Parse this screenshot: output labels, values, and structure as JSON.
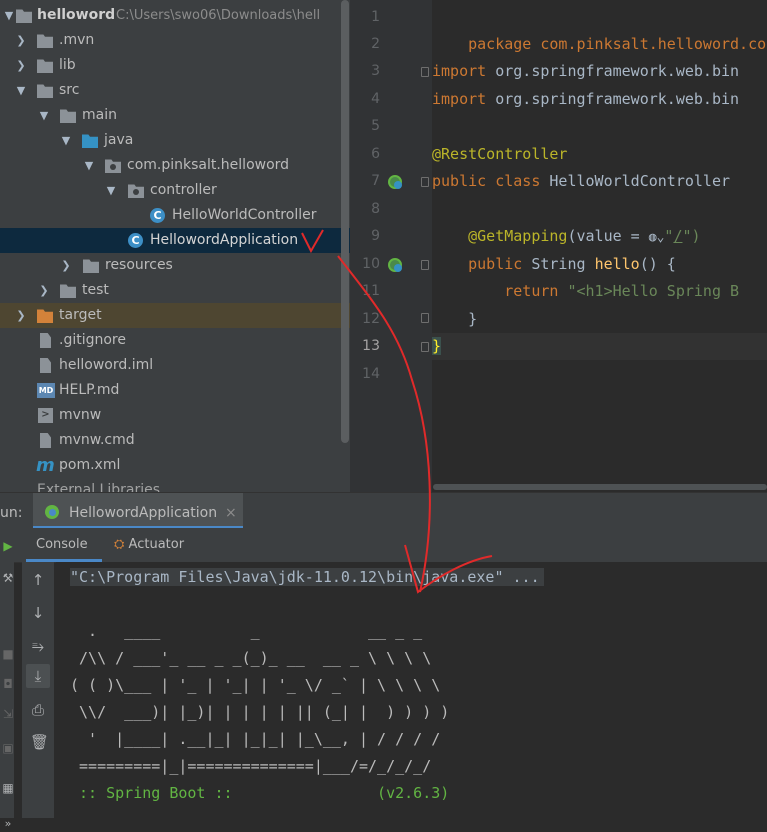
{
  "project_tree": {
    "root": {
      "name": "helloword",
      "path": "C:\\Users\\swo06\\Downloads\\hell"
    },
    "items": [
      {
        "label": ".mvn"
      },
      {
        "label": "lib"
      },
      {
        "label": "src"
      },
      {
        "label": "main"
      },
      {
        "label": "java"
      },
      {
        "label": "com.pinksalt.helloword"
      },
      {
        "label": "controller"
      },
      {
        "label": "HelloWorldController"
      },
      {
        "label": "HellowordApplication"
      },
      {
        "label": "resources"
      },
      {
        "label": "test"
      },
      {
        "label": "target"
      },
      {
        "label": ".gitignore"
      },
      {
        "label": "helloword.iml"
      },
      {
        "label": "HELP.md"
      },
      {
        "label": "mvnw"
      },
      {
        "label": "mvnw.cmd"
      },
      {
        "label": "pom.xml"
      },
      {
        "label": "External Libraries"
      }
    ]
  },
  "editor": {
    "current_line": "13",
    "lines": [
      {
        "n": "1",
        "code": [
          "package com.pinksalt.helloword.con"
        ]
      },
      {
        "n": "2"
      },
      {
        "n": "3",
        "code": [
          "import",
          " org.springframework.web.bin"
        ]
      },
      {
        "n": "4",
        "code": [
          "import",
          " org.springframework.web.bin"
        ]
      },
      {
        "n": "5"
      },
      {
        "n": "6",
        "code": [
          "@RestController"
        ]
      },
      {
        "n": "7",
        "code": [
          "public class",
          " HelloWorldController"
        ]
      },
      {
        "n": "8"
      },
      {
        "n": "9",
        "code": [
          "    @GetMapping",
          "(value = ",
          "\"",
          "/",
          "\")"
        ]
      },
      {
        "n": "10",
        "code": [
          "    public",
          " String ",
          "hello",
          "() {"
        ]
      },
      {
        "n": "11",
        "code": [
          "        return",
          " \"<h1>Hello Spring B"
        ]
      },
      {
        "n": "12",
        "code": [
          "    }"
        ]
      },
      {
        "n": "13",
        "code": [
          "}"
        ]
      },
      {
        "n": "14"
      }
    ]
  },
  "run_panel": {
    "title": "un:",
    "tab": {
      "label": "HellowordApplication",
      "close": "×"
    },
    "subtabs": {
      "console": "Console",
      "actuator": "Actuator"
    },
    "console_lines": [
      "\"C:\\Program Files\\Java\\jdk-11.0.12\\bin\\java.exe\" ...",
      "",
      "  .   ____          _            __ _ _",
      " /\\\\ / ___'_ __ _ _(_)_ __  __ _ \\ \\ \\ \\",
      "( ( )\\___ | '_ | '_| | '_ \\/ _` | \\ \\ \\ \\",
      " \\\\/  ___)| |_)| | | | | || (_| |  ) ) ) )",
      "  '  |____| .__|_| |_|_| |_\\__, | / / / /",
      " =========|_|==============|___/=/_/_/_/",
      " :: Spring Boot ::                (v2.6.3)"
    ]
  },
  "icons": {
    "tree_arrow_collapsed": "chevron-right-icon",
    "tree_arrow_expanded": "chevron-down-icon",
    "folder": "folder-icon",
    "spring_bean": "spring-bean-icon",
    "rerun": "rerun-icon",
    "scroll_up": "arrow-up-icon",
    "scroll_down": "arrow-down-icon",
    "soft_wrap": "soft-wrap-icon",
    "scroll_to_end": "scroll-to-end-icon",
    "print": "print-icon",
    "clear": "trash-icon"
  },
  "colors": {
    "selection": "#0d293e",
    "excluded": "#4e4631",
    "keyword": "#cc7832",
    "annotation": "#bbb529",
    "string": "#6a8759",
    "spring_green": "#62b543",
    "annotation_red": "#e02a2a"
  }
}
